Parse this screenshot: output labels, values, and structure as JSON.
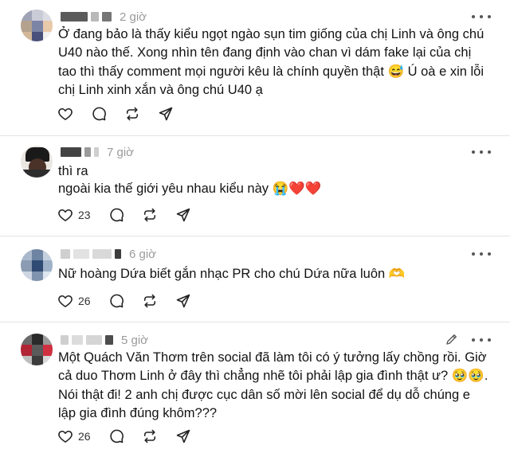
{
  "comments": [
    {
      "time": "2 giờ",
      "text": "Ở đang bảo là thấy kiểu ngọt ngào sụn tim giống của chị Linh và ông chú U40 nào thế. Xong nhìn tên đang định vào chan vì dám fake lại của chị tao thì thấy comment mọi người kêu là chính quyền thật 😅 Ú oà e xin lỗi chị Linh xinh xắn và ông chú U40 ạ",
      "like_count": ""
    },
    {
      "time": "7 giờ",
      "line1": "thì ra",
      "line2": "ngoài kia thế giới yêu nhau kiểu này 😭❤️❤️",
      "like_count": "23"
    },
    {
      "time": "6 giờ",
      "text": "Nữ hoàng Dứa biết gắn nhạc PR cho chú Dứa nữa luôn 🫶",
      "like_count": "26"
    },
    {
      "time": "5 giờ",
      "text": "Một Quách Văn Thơm trên social đã làm tôi có ý tưởng lấy chồng rồi. Giờ cả duo Thơm Linh ở đây thì chẳng nhẽ tôi phải lập gia đình thật ư? 🥹🥹. Nói thật đi! 2 anh chị được cục dân số mời lên social để dụ dỗ chúng e lập gia đình đúng khôm???",
      "like_count": "26"
    }
  ],
  "icons": [
    "heart-icon",
    "comment-icon",
    "repost-icon",
    "share-icon",
    "more-icon",
    "edit-icon"
  ],
  "colors": {
    "text": "#121212",
    "muted": "#9a9a9a",
    "separator": "#e4e4e4"
  }
}
